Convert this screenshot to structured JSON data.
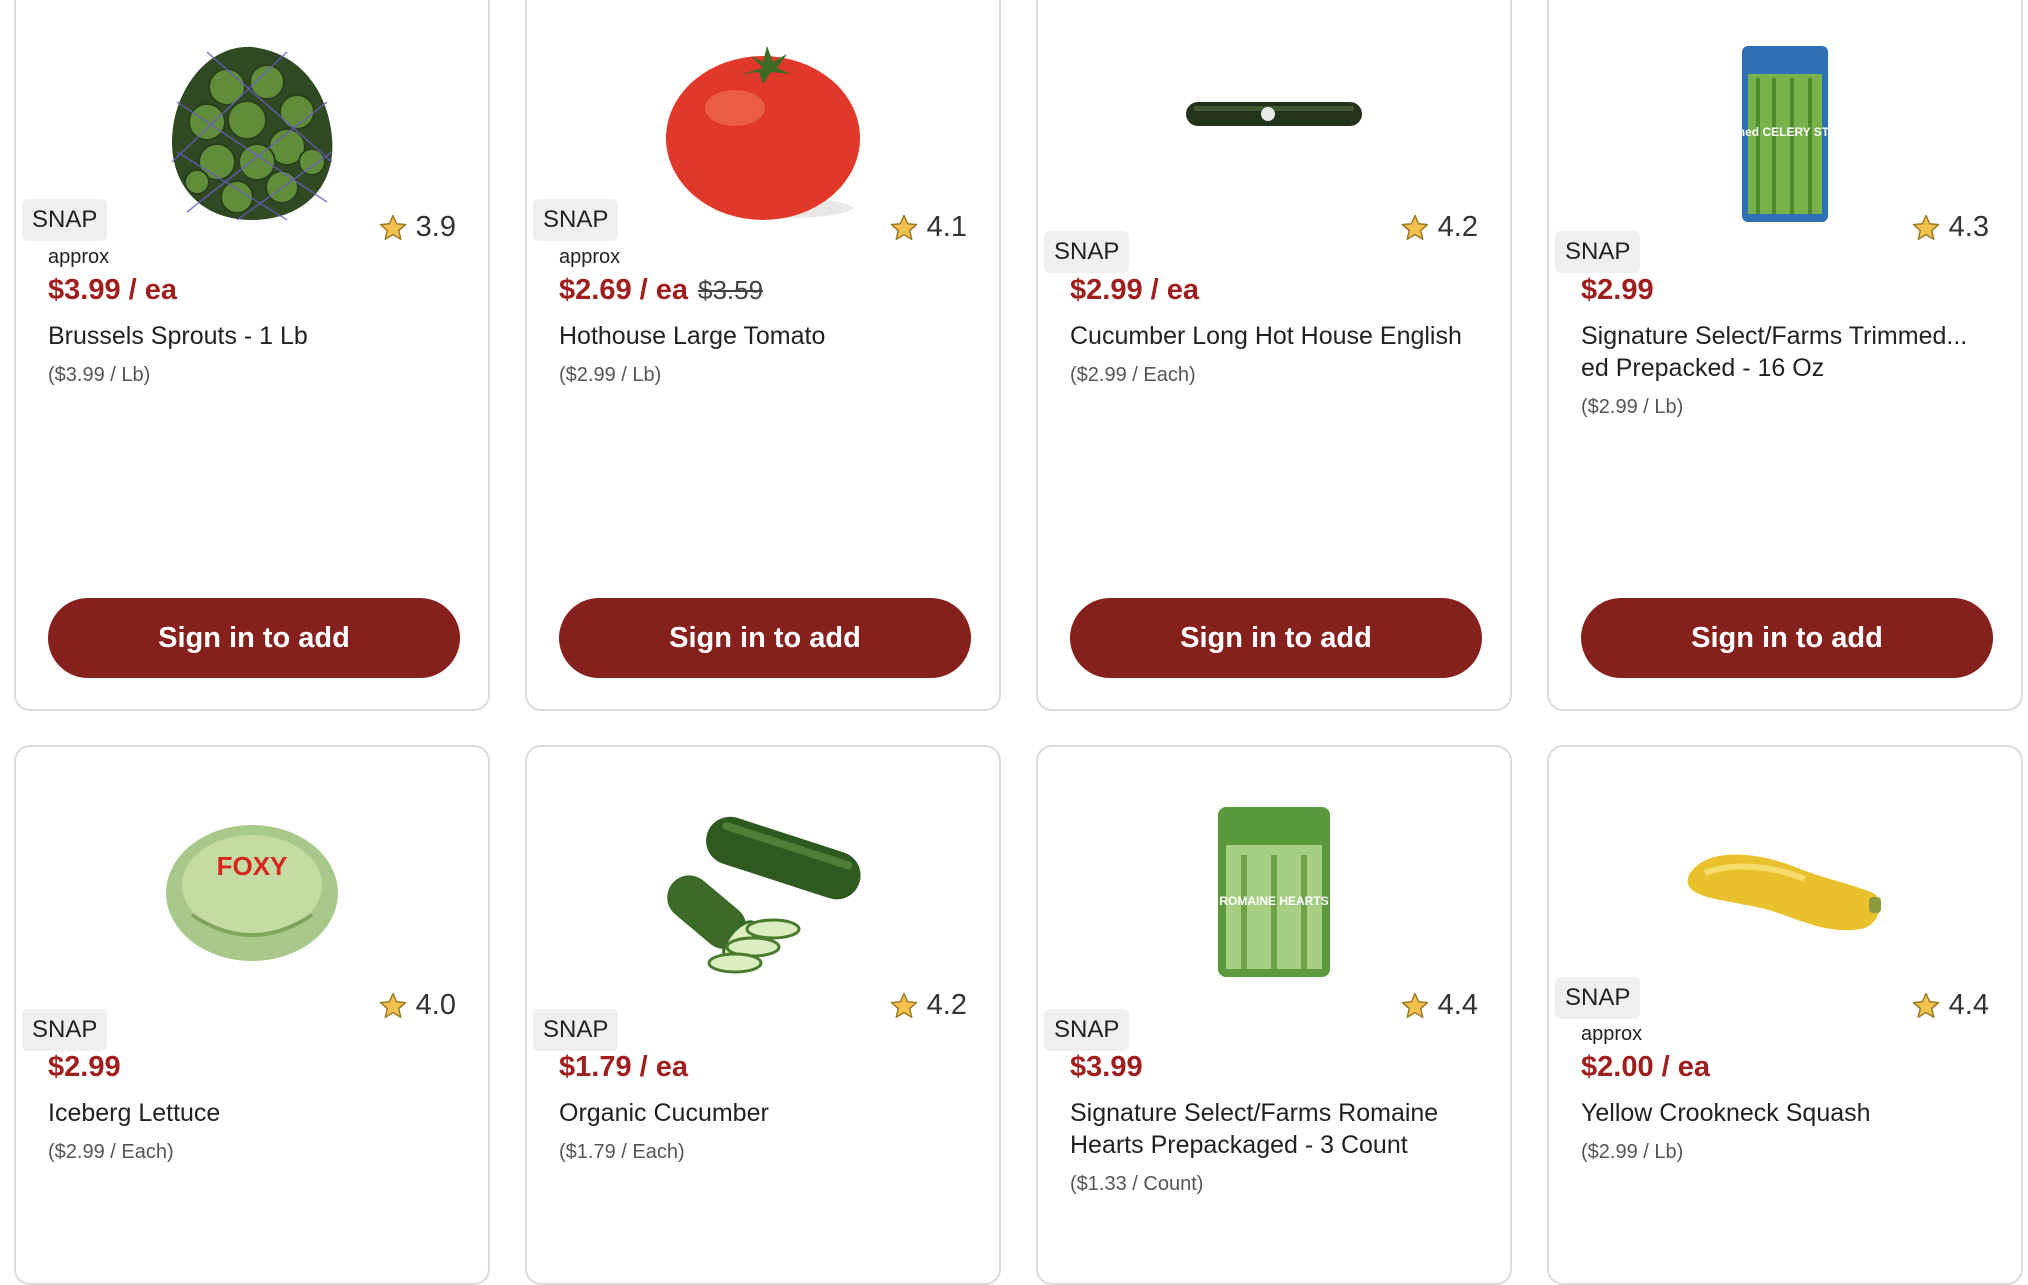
{
  "button_label": "Sign in to add",
  "products": [
    {
      "snap": "SNAP",
      "rating": "3.9",
      "approx": "approx",
      "price": "$3.99 / ea",
      "orig_price": "",
      "name": "Brussels Sprouts - 1 Lb",
      "unit_price": "($3.99 / Lb)",
      "image": "brussels-sprouts-image"
    },
    {
      "snap": "SNAP",
      "rating": "4.1",
      "approx": "approx",
      "price": "$2.69 / ea",
      "orig_price": "$3.59",
      "name": "Hothouse Large Tomato",
      "unit_price": "($2.99 / Lb)",
      "image": "tomato-image"
    },
    {
      "snap": "SNAP",
      "rating": "4.2",
      "approx": "",
      "price": "$2.99 / ea",
      "orig_price": "",
      "name": "Cucumber Long Hot House English",
      "unit_price": "($2.99 / Each)",
      "image": "english-cucumber-image"
    },
    {
      "snap": "SNAP",
      "rating": "4.3",
      "approx": "",
      "price": "$2.99",
      "orig_price": "",
      "name": "Signature Select/Farms Trimmed... ed Prepacked - 16 Oz",
      "unit_price": "($2.99 / Lb)",
      "image": "celery-stalks-image",
      "image_text": "Trimmed CELERY STALKS"
    },
    {
      "snap": "SNAP",
      "rating": "4.0",
      "approx": "",
      "price": "$2.99",
      "orig_price": "",
      "name": "Iceberg Lettuce",
      "unit_price": "($2.99 / Each)",
      "image": "iceberg-lettuce-image",
      "image_text": "FOXY"
    },
    {
      "snap": "SNAP",
      "rating": "4.2",
      "approx": "",
      "price": "$1.79 / ea",
      "orig_price": "",
      "name": "Organic Cucumber",
      "unit_price": "($1.79 / Each)",
      "image": "cucumber-image"
    },
    {
      "snap": "SNAP",
      "rating": "4.4",
      "approx": "",
      "price": "$3.99",
      "orig_price": "",
      "name": "Signature Select/Farms Romaine Hearts Prepackaged - 3 Count",
      "unit_price": "($1.33 / Count)",
      "image": "romaine-hearts-image",
      "image_text": "ROMAINE HEARTS"
    },
    {
      "snap": "SNAP",
      "rating": "4.4",
      "approx": "approx",
      "price": "$2.00 / ea",
      "orig_price": "",
      "name": "Yellow Crookneck Squash",
      "unit_price": "($2.99 / Lb)",
      "image": "yellow-squash-image"
    }
  ],
  "colors": {
    "price": "#a01e1e",
    "button": "#86201d",
    "star": "#f2c14e"
  }
}
